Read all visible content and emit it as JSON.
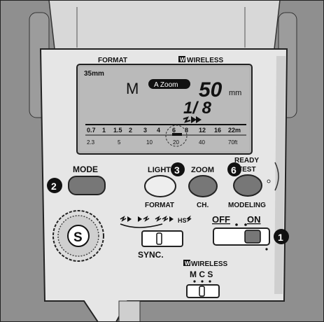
{
  "header": {
    "format_label": "FORMAT",
    "wireless_label": "WIRELESS",
    "wireless_badge": "W"
  },
  "lcd": {
    "focal_tag": "35mm",
    "mode_letter": "M",
    "azoom_badge": "A Zoom",
    "zoom_value": "50",
    "zoom_unit": "mm",
    "power_ratio": "1/ 8",
    "scale_top": [
      "0.7",
      "1",
      "1.5",
      "2",
      "3",
      "4",
      "6",
      "8",
      "12",
      "16",
      "22m"
    ],
    "scale_bottom": [
      "2.3",
      "5",
      "10",
      "20",
      "40",
      "70ft"
    ]
  },
  "controls": {
    "mode_button": "MODE",
    "light_button": "LIGHT",
    "zoom_button": "ZOOM",
    "ready_label": "READY",
    "test_label": "TEST",
    "format_label": "FORMAT",
    "ch_label": "CH.",
    "modeling_label": "MODELING",
    "s_dial": "S",
    "off_label": "OFF",
    "on_label": "ON",
    "hs_label": "HS",
    "sync_label": "SYNC.",
    "wireless_label": "WIRELESS",
    "wireless_badge": "W",
    "mcs_label": "M C S"
  },
  "callouts": {
    "c1": "1",
    "c2": "2",
    "c3": "3",
    "c6": "6"
  },
  "colors": {
    "background": "#8f8f8f",
    "body": "#e6e6e6",
    "lcd": "#b4b4b4",
    "button": "#777777",
    "callout": "#111111"
  }
}
